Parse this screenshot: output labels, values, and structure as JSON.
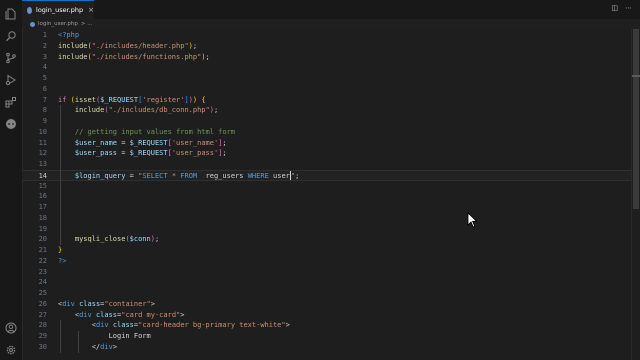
{
  "tab": {
    "label": "login_user.php",
    "close": "×"
  },
  "breadcrumb": {
    "file": "login_user.php",
    "rest": "> ..."
  },
  "editor_actions": [
    "◫",
    "⋯"
  ],
  "cursor_line": 14,
  "lines": [
    {
      "n": "1",
      "tokens": [
        [
          "t-tag",
          "<?php"
        ]
      ]
    },
    {
      "n": "2",
      "tokens": [
        [
          "t-fn",
          "include"
        ],
        [
          "t-br1",
          "("
        ],
        [
          "t-str",
          "\"./includes/header.php\""
        ],
        [
          "t-br1",
          ")"
        ],
        [
          "t-punc",
          ";"
        ]
      ]
    },
    {
      "n": "3",
      "tokens": [
        [
          "t-fn",
          "include"
        ],
        [
          "t-br1",
          "("
        ],
        [
          "t-str",
          "\"./includes/functions.php\""
        ],
        [
          "t-br1",
          ")"
        ],
        [
          "t-punc",
          ";"
        ]
      ]
    },
    {
      "n": "4",
      "tokens": []
    },
    {
      "n": "5",
      "tokens": []
    },
    {
      "n": "6",
      "tokens": []
    },
    {
      "n": "7",
      "tokens": [
        [
          "t-kw",
          "if"
        ],
        [
          "t-punc",
          " "
        ],
        [
          "t-br1",
          "("
        ],
        [
          "t-fn",
          "isset"
        ],
        [
          "t-br2",
          "("
        ],
        [
          "t-var",
          "$_REQUEST"
        ],
        [
          "t-br3",
          "["
        ],
        [
          "t-str",
          "'register'"
        ],
        [
          "t-br3",
          "]"
        ],
        [
          "t-br2",
          ")"
        ],
        [
          "t-br1",
          ")"
        ],
        [
          "t-punc",
          " "
        ],
        [
          "t-br1",
          "{"
        ]
      ]
    },
    {
      "n": "8",
      "tokens": [
        [
          "t-punc",
          "    "
        ],
        [
          "t-fn",
          "include"
        ],
        [
          "t-br2",
          "("
        ],
        [
          "t-str",
          "\"./includes/db_conn.php\""
        ],
        [
          "t-br2",
          ")"
        ],
        [
          "t-punc",
          ";"
        ]
      ]
    },
    {
      "n": "9",
      "tokens": []
    },
    {
      "n": "10",
      "tokens": [
        [
          "t-punc",
          "    "
        ],
        [
          "t-cmt",
          "// getting input values from html form"
        ]
      ]
    },
    {
      "n": "11",
      "tokens": [
        [
          "t-punc",
          "    "
        ],
        [
          "t-var",
          "$user_name"
        ],
        [
          "t-punc",
          " = "
        ],
        [
          "t-var",
          "$_REQUEST"
        ],
        [
          "t-br2",
          "["
        ],
        [
          "t-str",
          "'user_name'"
        ],
        [
          "t-br2",
          "]"
        ],
        [
          "t-punc",
          ";"
        ]
      ]
    },
    {
      "n": "12",
      "tokens": [
        [
          "t-punc",
          "    "
        ],
        [
          "t-var",
          "$user_pass"
        ],
        [
          "t-punc",
          " = "
        ],
        [
          "t-var",
          "$_REQUEST"
        ],
        [
          "t-br2",
          "["
        ],
        [
          "t-str",
          "'user_pass'"
        ],
        [
          "t-br2",
          "]"
        ],
        [
          "t-punc",
          ";"
        ]
      ]
    },
    {
      "n": "13",
      "tokens": []
    },
    {
      "n": "14",
      "tokens": [
        [
          "t-punc",
          "    "
        ],
        [
          "t-var",
          "$login_query"
        ],
        [
          "t-punc",
          " = "
        ],
        [
          "t-str",
          "\""
        ],
        [
          "t-sql",
          "SELECT"
        ],
        [
          "t-str",
          " * "
        ],
        [
          "t-sql",
          "FROM"
        ],
        [
          "t-str",
          "  "
        ],
        [
          "t-txt",
          "reg_users"
        ],
        [
          "t-str",
          " "
        ],
        [
          "t-sql",
          "WHERE"
        ],
        [
          "t-str",
          " "
        ],
        [
          "t-txt",
          "user"
        ],
        [
          "cursor",
          ""
        ],
        [
          "t-str",
          "\""
        ],
        [
          "t-punc",
          ";"
        ]
      ]
    },
    {
      "n": "15",
      "tokens": []
    },
    {
      "n": "16",
      "tokens": []
    },
    {
      "n": "17",
      "tokens": []
    },
    {
      "n": "18",
      "tokens": []
    },
    {
      "n": "19",
      "tokens": []
    },
    {
      "n": "20",
      "tokens": [
        [
          "t-punc",
          "    "
        ],
        [
          "t-fn",
          "mysqli_close"
        ],
        [
          "t-br2",
          "("
        ],
        [
          "t-var",
          "$conn"
        ],
        [
          "t-br2",
          ")"
        ],
        [
          "t-punc",
          ";"
        ]
      ]
    },
    {
      "n": "21",
      "tokens": [
        [
          "t-br1",
          "}"
        ]
      ]
    },
    {
      "n": "22",
      "tokens": [
        [
          "t-tag",
          "?>"
        ]
      ]
    },
    {
      "n": "23",
      "tokens": []
    },
    {
      "n": "24",
      "tokens": []
    },
    {
      "n": "25",
      "tokens": []
    },
    {
      "n": "26",
      "tokens": [
        [
          "t-punc",
          "<"
        ],
        [
          "t-tag",
          "div"
        ],
        [
          "t-punc",
          " "
        ],
        [
          "t-var",
          "class"
        ],
        [
          "t-punc",
          "="
        ],
        [
          "t-str",
          "\"container\""
        ],
        [
          "t-punc",
          ">"
        ]
      ]
    },
    {
      "n": "27",
      "tokens": [
        [
          "t-punc",
          "    <"
        ],
        [
          "t-tag",
          "div"
        ],
        [
          "t-punc",
          " "
        ],
        [
          "t-var",
          "class"
        ],
        [
          "t-punc",
          "="
        ],
        [
          "t-str",
          "\"card my-card\""
        ],
        [
          "t-punc",
          ">"
        ]
      ]
    },
    {
      "n": "28",
      "tokens": [
        [
          "t-punc",
          "        <"
        ],
        [
          "t-tag",
          "div"
        ],
        [
          "t-punc",
          " "
        ],
        [
          "t-var",
          "class"
        ],
        [
          "t-punc",
          "="
        ],
        [
          "t-str",
          "\"card-header bg-primary text-white\""
        ],
        [
          "t-punc",
          ">"
        ]
      ]
    },
    {
      "n": "29",
      "tokens": [
        [
          "t-punc",
          "            "
        ],
        [
          "t-txt",
          "Login Form"
        ]
      ]
    },
    {
      "n": "30",
      "tokens": [
        [
          "t-punc",
          "        </"
        ],
        [
          "t-tag",
          "div"
        ],
        [
          "t-punc",
          ">"
        ]
      ]
    }
  ],
  "activity_icons": [
    "files-icon",
    "search-icon",
    "source-control-icon",
    "run-debug-icon",
    "extensions-icon",
    "chat-icon",
    "account-icon",
    "settings-gear-icon"
  ]
}
